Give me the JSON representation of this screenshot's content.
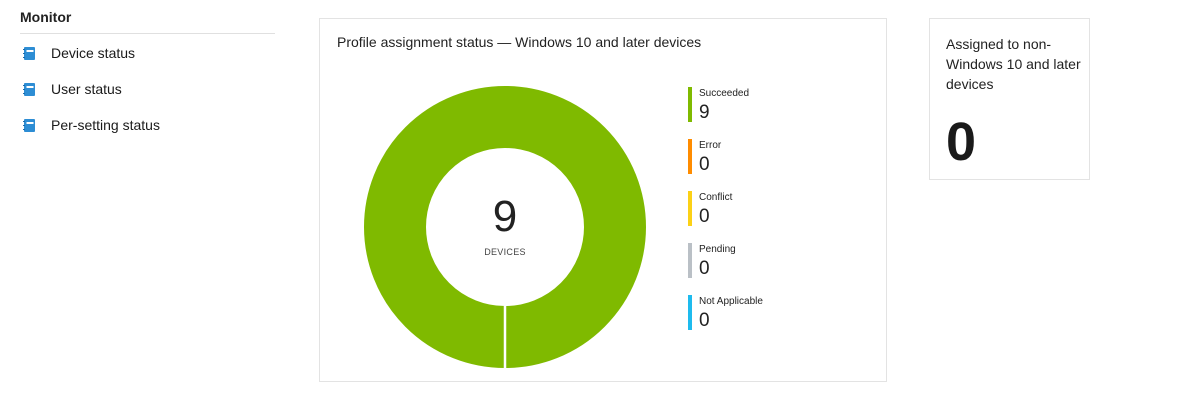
{
  "sidebar": {
    "title": "Monitor",
    "items": [
      {
        "label": "Device status"
      },
      {
        "label": "User status"
      },
      {
        "label": "Per-setting status"
      }
    ]
  },
  "main_card": {
    "title": "Profile assignment status — Windows 10 and later devices",
    "total": "9",
    "total_label": "DEVICES",
    "legend": [
      {
        "label": "Succeeded",
        "value": "9",
        "color": "#7fba00"
      },
      {
        "label": "Error",
        "value": "0",
        "color": "#ff8c00"
      },
      {
        "label": "Conflict",
        "value": "0",
        "color": "#fcd116"
      },
      {
        "label": "Pending",
        "value": "0",
        "color": "#bac0c6"
      },
      {
        "label": "Not Applicable",
        "value": "0",
        "color": "#1ebbee"
      }
    ]
  },
  "side_card": {
    "title": "Assigned to non-Windows 10 and later devices",
    "value": "0"
  },
  "icons": {
    "nav_icon": "notebook-icon",
    "nav_icon_color": "#2d8dd4"
  },
  "chart_data": {
    "type": "pie",
    "categories": [
      "Succeeded",
      "Error",
      "Conflict",
      "Pending",
      "Not Applicable"
    ],
    "values": [
      9,
      0,
      0,
      0,
      0
    ],
    "colors": [
      "#7fba00",
      "#ff8c00",
      "#fcd116",
      "#bac0c6",
      "#1ebbee"
    ],
    "title": "Profile assignment status — Windows 10 and later devices",
    "donut": true,
    "legend": "right"
  }
}
